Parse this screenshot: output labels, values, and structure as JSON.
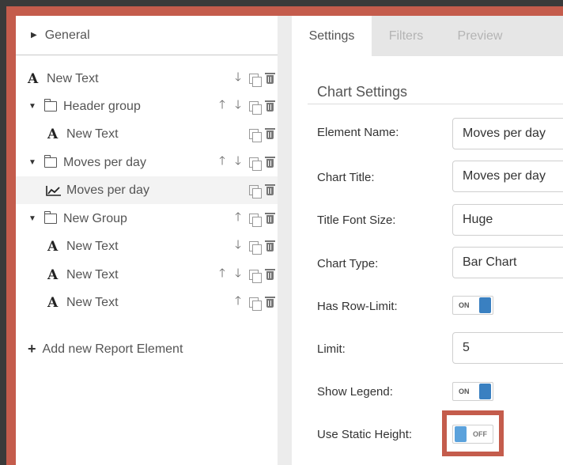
{
  "tree": {
    "general_label": "General",
    "items": [
      {
        "label": "New Text",
        "type": "text",
        "indent": 0
      },
      {
        "label": "Header group",
        "type": "group",
        "indent": 0
      },
      {
        "label": "New Text",
        "type": "text",
        "indent": 1
      },
      {
        "label": "Moves per day",
        "type": "group",
        "indent": 0
      },
      {
        "label": "Moves per day",
        "type": "chart",
        "indent": 1,
        "selected": true
      },
      {
        "label": "New Group",
        "type": "group",
        "indent": 0
      },
      {
        "label": "New Text",
        "type": "text",
        "indent": 1
      },
      {
        "label": "New Text",
        "type": "text",
        "indent": 1
      },
      {
        "label": "New Text",
        "type": "text",
        "indent": 1
      }
    ],
    "add_label": "Add new Report Element"
  },
  "tabs": [
    {
      "label": "Settings",
      "active": true
    },
    {
      "label": "Filters",
      "active": false
    },
    {
      "label": "Preview",
      "active": false
    }
  ],
  "settings": {
    "section_title": "Chart Settings",
    "element_name_label": "Element Name:",
    "element_name_value": "Moves per day",
    "chart_title_label": "Chart Title:",
    "chart_title_value": "Moves per day",
    "title_font_size_label": "Title Font Size:",
    "title_font_size_value": "Huge",
    "chart_type_label": "Chart Type:",
    "chart_type_value": "Bar Chart",
    "has_row_limit_label": "Has Row-Limit:",
    "has_row_limit_state": "ON",
    "limit_label": "Limit:",
    "limit_value": "5",
    "show_legend_label": "Show Legend:",
    "show_legend_state": "ON",
    "use_static_height_label": "Use Static Height:",
    "use_static_height_state": "OFF"
  },
  "colors": {
    "frame": "#c45c4c",
    "toggle_on": "#3a80c1",
    "toggle_off_knob": "#5ba2dc"
  }
}
